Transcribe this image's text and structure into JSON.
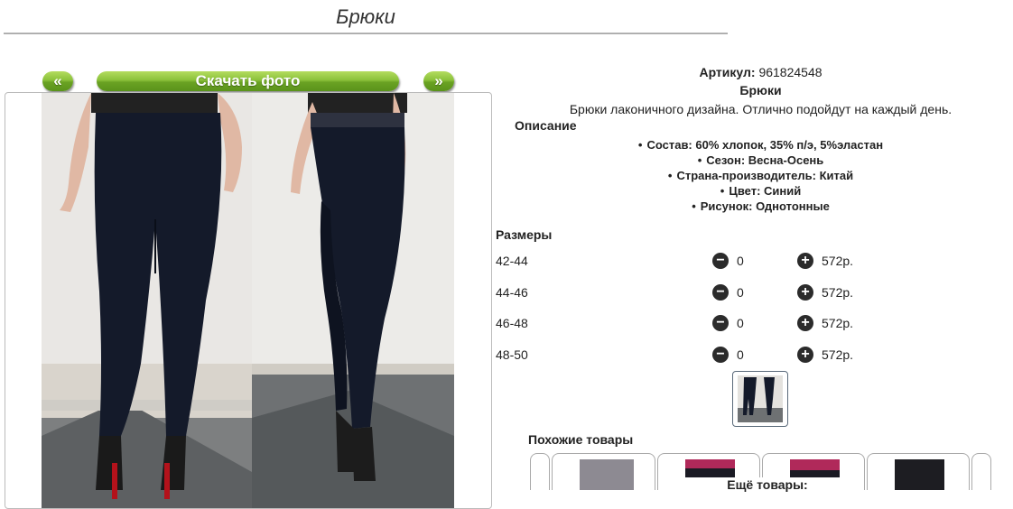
{
  "page": {
    "title": "Брюки"
  },
  "gallery": {
    "prev_label": "«",
    "download_label": "Скачать фото",
    "next_label": "»"
  },
  "product": {
    "sku_label": "Артикул:",
    "sku_value": "961824548",
    "name": "Брюки",
    "description": "Брюки лаконичного дизайна. Отлично подойдут на каждый день.",
    "description_heading": "Описание",
    "specs": [
      "Состав: 60% хлопок, 35% п/э, 5%эластан",
      "Сезон: Весна-Осень",
      "Страна-производитель: Китай",
      "Цвет: Синий",
      "Рисунок: Однотонные"
    ]
  },
  "sizes": {
    "heading": "Размеры",
    "rows": [
      {
        "size": "42-44",
        "qty": "0",
        "price": "572р."
      },
      {
        "size": "44-46",
        "qty": "0",
        "price": "572р."
      },
      {
        "size": "46-48",
        "qty": "0",
        "price": "572р."
      },
      {
        "size": "48-50",
        "qty": "0",
        "price": "572р."
      }
    ],
    "minus_glyph": "−",
    "plus_glyph": "+"
  },
  "similar": {
    "heading": "Похожие товары",
    "more_label": "Ещё товары:"
  },
  "colors": {
    "accent_green": "#6aa223",
    "pants_navy": "#141a2a",
    "button_dark": "#2b2b2b"
  }
}
